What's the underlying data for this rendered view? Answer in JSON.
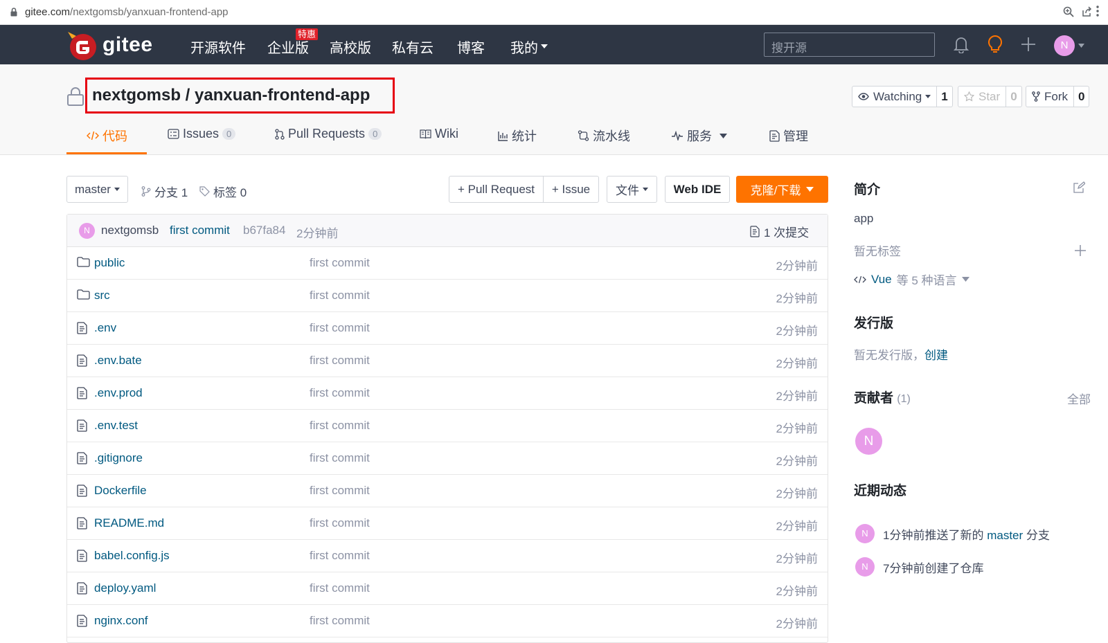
{
  "browser": {
    "url_host": "gitee.com",
    "url_path": "/nextgomsb/yanxuan-frontend-app"
  },
  "header": {
    "logo_text": "gitee",
    "nav": [
      "开源软件",
      "企业版",
      "高校版",
      "私有云",
      "博客",
      "我的"
    ],
    "enterprise_badge": "特惠",
    "search_placeholder": "搜开源",
    "user_avatar": "N",
    "colors": {
      "bar": "#2e3644",
      "accent": "#fe7300",
      "brand_red": "#c71d23"
    }
  },
  "repo": {
    "title": "nextgomsb / yanxuan-frontend-app",
    "watch_label": "Watching",
    "watch_count": "1",
    "star_label": "Star",
    "star_count": "0",
    "fork_label": "Fork",
    "fork_count": "0",
    "tabs": [
      {
        "label": "代码",
        "icon": "code-icon"
      },
      {
        "label": "Issues",
        "count": "0",
        "icon": "issues-icon"
      },
      {
        "label": "Pull Requests",
        "count": "0",
        "icon": "pull-request-icon"
      },
      {
        "label": "Wiki",
        "icon": "wiki-icon"
      },
      {
        "label": "统计",
        "icon": "chart-icon"
      },
      {
        "label": "流水线",
        "icon": "pipeline-icon"
      },
      {
        "label": "服务",
        "icon": "pulse-icon"
      },
      {
        "label": "管理",
        "icon": "manage-icon"
      }
    ]
  },
  "toolbar": {
    "branch": "master",
    "branches": "分支 1",
    "tags": "标签 0",
    "pull_request": "+ Pull Request",
    "issue": "+ Issue",
    "file": "文件",
    "web_ide": "Web IDE",
    "clone": "克隆/下载"
  },
  "commit": {
    "avatar": "N",
    "author": "nextgomsb",
    "message": "first commit",
    "hash": "b67fa84",
    "time": "2分钟前",
    "count_label": "1 次提交"
  },
  "files": [
    {
      "name": "public",
      "type": "folder",
      "message": "first commit",
      "time": "2分钟前"
    },
    {
      "name": "src",
      "type": "folder",
      "message": "first commit",
      "time": "2分钟前"
    },
    {
      "name": ".env",
      "type": "file",
      "message": "first commit",
      "time": "2分钟前"
    },
    {
      "name": ".env.bate",
      "type": "file",
      "message": "first commit",
      "time": "2分钟前"
    },
    {
      "name": ".env.prod",
      "type": "file",
      "message": "first commit",
      "time": "2分钟前"
    },
    {
      "name": ".env.test",
      "type": "file",
      "message": "first commit",
      "time": "2分钟前"
    },
    {
      "name": ".gitignore",
      "type": "file",
      "message": "first commit",
      "time": "2分钟前"
    },
    {
      "name": "Dockerfile",
      "type": "file",
      "message": "first commit",
      "time": "2分钟前"
    },
    {
      "name": "README.md",
      "type": "file",
      "message": "first commit",
      "time": "2分钟前"
    },
    {
      "name": "babel.config.js",
      "type": "file",
      "message": "first commit",
      "time": "2分钟前"
    },
    {
      "name": "deploy.yaml",
      "type": "file",
      "message": "first commit",
      "time": "2分钟前"
    },
    {
      "name": "nginx.conf",
      "type": "file",
      "message": "first commit",
      "time": "2分钟前"
    }
  ],
  "sidebar": {
    "intro_title": "简介",
    "intro_text": "app",
    "no_tags": "暂无标签",
    "lang_name": "Vue",
    "lang_rest": "等 5 种语言",
    "release_title": "发行版",
    "no_release": "暂无发行版，",
    "create_label": "创建",
    "contrib_title": "贡献者",
    "contrib_count": "(1)",
    "all_label": "全部",
    "contrib_avatar": "N",
    "activity_title": "近期动态",
    "activities": [
      {
        "avatar": "N",
        "pre": "1分钟前推送了新的",
        "link": "master",
        "post": "分支"
      },
      {
        "avatar": "N",
        "pre": "7分钟前创建了仓库",
        "link": "",
        "post": ""
      }
    ]
  }
}
